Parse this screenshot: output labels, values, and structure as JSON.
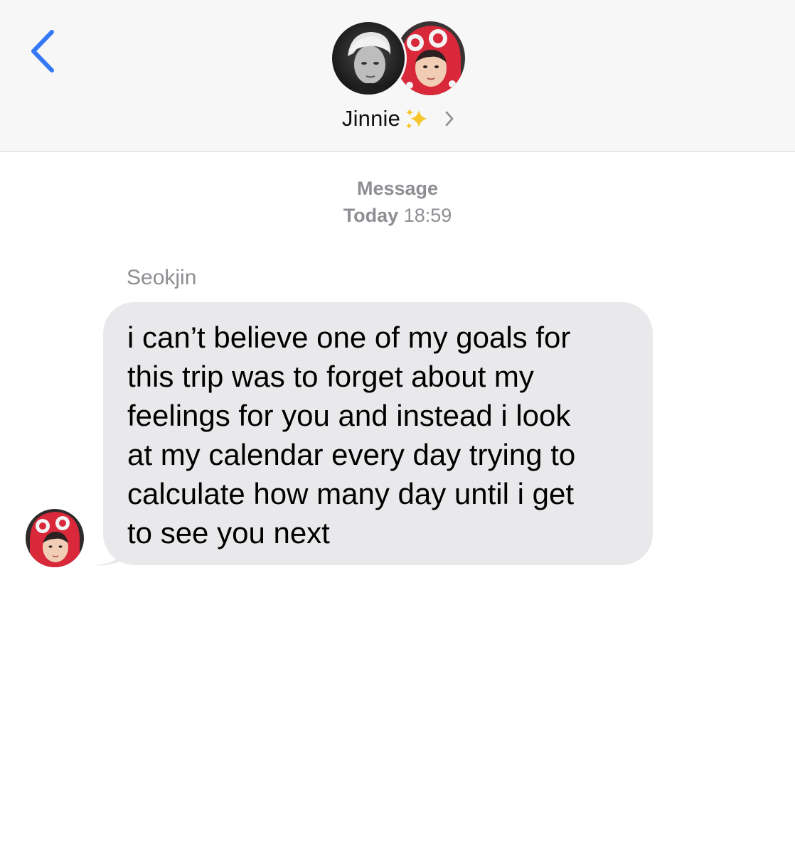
{
  "header": {
    "contact_name": "Jinnie",
    "icons": {
      "back": "chevron-left-icon",
      "sparkles": "sparkles-icon",
      "details": "chevron-right-icon"
    },
    "accent_color": "#3478f6"
  },
  "thread": {
    "service": "Message",
    "day": "Today",
    "time": "18:59"
  },
  "messages": [
    {
      "sender": "Seokjin",
      "text": "i can’t believe one of my goals for\nthis trip was to forget about my\nfeelings for you and instead i look\nat my calendar every day trying to\ncalculate how many day until i get\nto see you next"
    }
  ],
  "colors": {
    "header_bg": "#f7f7f7",
    "bubble_bg": "#e9e9eb",
    "meta_text": "#8e8e93"
  }
}
